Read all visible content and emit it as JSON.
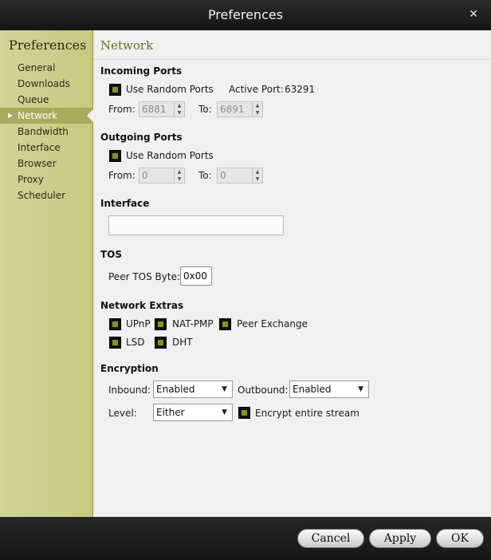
{
  "window": {
    "title": "Preferences",
    "close_glyph": "✕"
  },
  "sidebar": {
    "title": "Preferences",
    "items": [
      {
        "label": "General"
      },
      {
        "label": "Downloads"
      },
      {
        "label": "Queue"
      },
      {
        "label": "Network"
      },
      {
        "label": "Bandwidth"
      },
      {
        "label": "Interface"
      },
      {
        "label": "Browser"
      },
      {
        "label": "Proxy"
      },
      {
        "label": "Scheduler"
      }
    ]
  },
  "page": {
    "title": "Network"
  },
  "incoming": {
    "title": "Incoming Ports",
    "random_label": "Use Random Ports",
    "random_checked": true,
    "active_port_label": "Active Port:",
    "active_port_value": "63291",
    "from_label": "From:",
    "from_value": "6881",
    "to_label": "To:",
    "to_value": "6891"
  },
  "outgoing": {
    "title": "Outgoing Ports",
    "random_label": "Use Random Ports",
    "random_checked": true,
    "from_label": "From:",
    "from_value": "0",
    "to_label": "To:",
    "to_value": "0"
  },
  "interface": {
    "title": "Interface",
    "value": ""
  },
  "tos": {
    "title": "TOS",
    "label": "Peer TOS Byte:",
    "value": "0x00"
  },
  "extras": {
    "title": "Network Extras",
    "upnp": "UPnP",
    "natpmp": "NAT-PMP",
    "pex": "Peer Exchange",
    "lsd": "LSD",
    "dht": "DHT"
  },
  "encryption": {
    "title": "Encryption",
    "inbound_label": "Inbound:",
    "inbound_value": "Enabled",
    "outbound_label": "Outbound:",
    "outbound_value": "Enabled",
    "level_label": "Level:",
    "level_value": "Either",
    "encrypt_stream_label": "Encrypt entire stream"
  },
  "footer": {
    "cancel": "Cancel",
    "apply": "Apply",
    "ok": "OK"
  },
  "colors": {
    "sidebar": "#cfd190",
    "accent": "#7c9a1c",
    "active_item": "#a9ab5c"
  }
}
